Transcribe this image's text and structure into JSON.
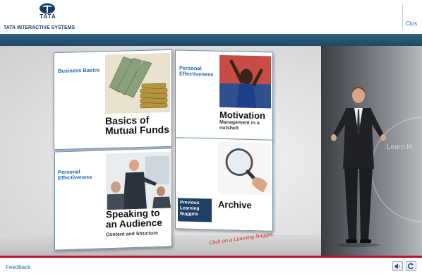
{
  "header": {
    "logo_wordmark": "TATA",
    "company_name_bold": "TATA",
    "company_name_rest": "INTERACTIVE SYSTEMS",
    "close_label": "Clos"
  },
  "tiles": {
    "mutual": {
      "category": "Business Basics",
      "title": "Basics of Mutual Funds"
    },
    "motivation": {
      "category": "Personal Effectiveness",
      "title": "Motivation",
      "subtitle": "Management in a nutshell"
    },
    "speaking": {
      "category": "Personal Effectiveness",
      "title": "Speaking to an Audience",
      "subtitle": "Content and Structure"
    },
    "archive": {
      "title": "Archive",
      "prev_label": "Previous Learning Nuggets"
    }
  },
  "hint": "Click on a Learning Nugget.",
  "backdrop_text": "Learn H",
  "footer": {
    "feedback_label": "Feedback",
    "audio_icon": "speaker-icon",
    "replay_icon": "replay-icon"
  },
  "colors": {
    "band": "#2a5675",
    "accent_red": "#b5142a",
    "category_blue": "#1f66b0",
    "nugget_box": "#1e3f66"
  }
}
